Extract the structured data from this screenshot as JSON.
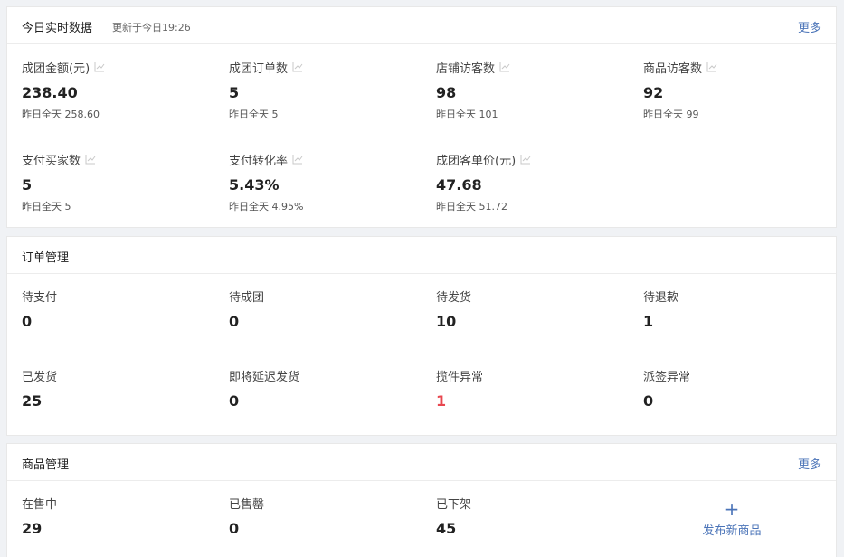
{
  "realtime": {
    "title": "今日实时数据",
    "updated": "更新于今日19:26",
    "more": "更多",
    "metrics": [
      {
        "label": "成团金额(元)",
        "value": "238.40",
        "sub": "昨日全天 258.60"
      },
      {
        "label": "成团订单数",
        "value": "5",
        "sub": "昨日全天 5"
      },
      {
        "label": "店铺访客数",
        "value": "98",
        "sub": "昨日全天 101"
      },
      {
        "label": "商品访客数",
        "value": "92",
        "sub": "昨日全天 99"
      },
      {
        "label": "支付买家数",
        "value": "5",
        "sub": "昨日全天 5"
      },
      {
        "label": "支付转化率",
        "value": "5.43%",
        "sub": "昨日全天 4.95%"
      },
      {
        "label": "成团客单价(元)",
        "value": "47.68",
        "sub": "昨日全天 51.72"
      }
    ]
  },
  "orders": {
    "title": "订单管理",
    "items": [
      {
        "label": "待支付",
        "value": "0"
      },
      {
        "label": "待成团",
        "value": "0"
      },
      {
        "label": "待发货",
        "value": "10"
      },
      {
        "label": "待退款",
        "value": "1"
      },
      {
        "label": "已发货",
        "value": "25"
      },
      {
        "label": "即将延迟发货",
        "value": "0"
      },
      {
        "label": "揽件异常",
        "value": "1"
      },
      {
        "label": "派签异常",
        "value": "0"
      }
    ]
  },
  "goods": {
    "title": "商品管理",
    "more": "更多",
    "items": [
      {
        "label": "在售中",
        "value": "29"
      },
      {
        "label": "已售罄",
        "value": "0"
      },
      {
        "label": "已下架",
        "value": "45"
      }
    ],
    "add_plus": "+",
    "add_label": "发布新商品"
  },
  "colors": {
    "accent": "#4b74b8",
    "alert": "#e8474f"
  },
  "icons": {
    "trend": "line-chart-icon"
  }
}
